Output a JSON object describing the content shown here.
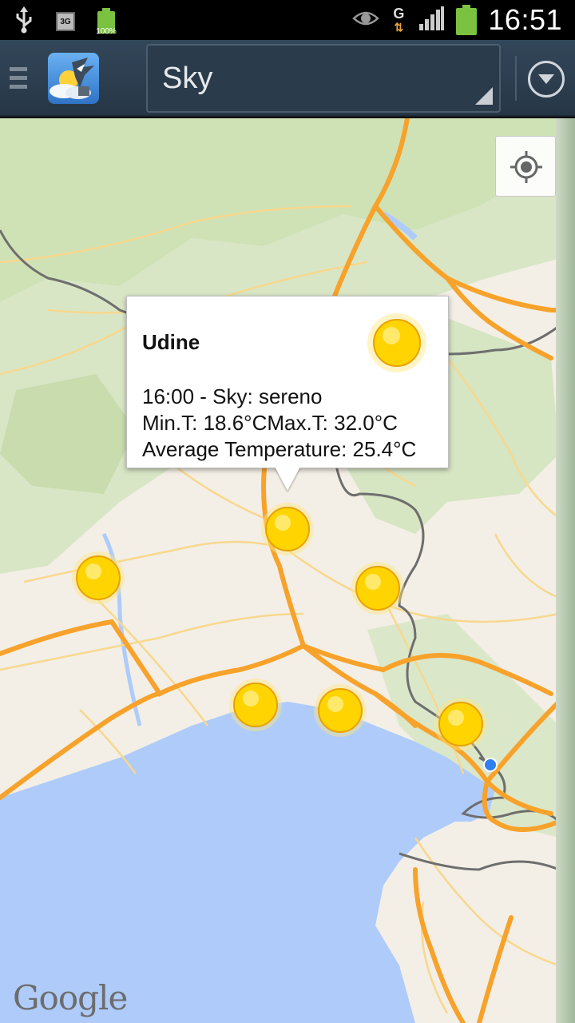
{
  "status_bar": {
    "time": "16:51",
    "battery_small_label": "100%",
    "network_badge": "3G",
    "data_network": "G",
    "icons": [
      "usb-icon",
      "3g-icon",
      "battery-icon",
      "eye-icon",
      "data-activity-icon",
      "signal-icon",
      "battery-icon"
    ]
  },
  "action_bar": {
    "spinner_value": "Sky",
    "icons": [
      "menu-icon",
      "app-logo-icon",
      "overflow-menu-icon"
    ]
  },
  "map": {
    "attribution": "Google",
    "my_location_icon": "crosshair-icon",
    "marker_icon": "sun-icon",
    "marker_count": 7
  },
  "info_window": {
    "title": "Udine",
    "line1": "16:00 - Sky: sereno",
    "line2": "Min.T: 18.6°CMax.T: 32.0°C",
    "line3": "Average Temperature: 25.4°C",
    "icon": "sun-icon"
  },
  "colors": {
    "action_bar": "#2d4051",
    "land": "#f3efe6",
    "sea": "#aecbfa",
    "highway": "#f7a22b",
    "forest": "#cfe2b6",
    "sun": "#ffd400"
  }
}
